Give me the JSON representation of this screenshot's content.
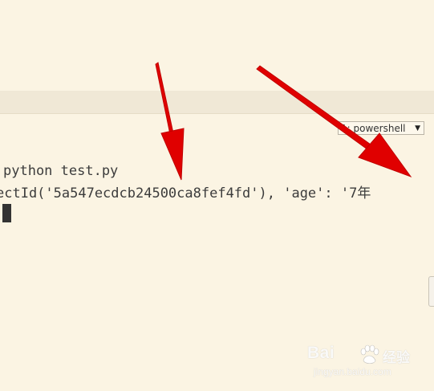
{
  "terminal_panel": {
    "shell_select": {
      "selected": "1: powershell"
    }
  },
  "terminal": {
    "lines": [
      "python test.py",
      "ectId('5a547ecdcb24500ca8fef4fd'), 'age': '7年"
    ]
  },
  "watermark": {
    "brand": "Bai",
    "brand_suffix": "经验",
    "url": "jingyan.baidu.com"
  },
  "colors": {
    "background": "#fbf4e3",
    "tabbar": "#f0e8d6",
    "annotation_arrow": "#e00000"
  }
}
